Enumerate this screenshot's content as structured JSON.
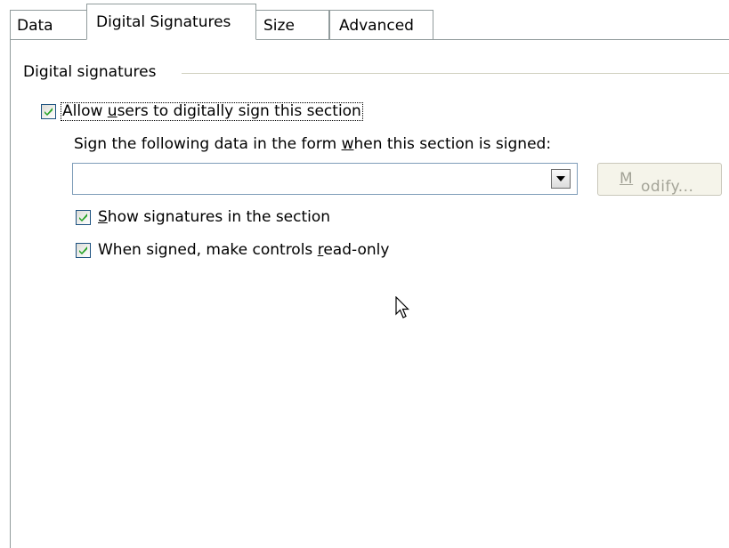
{
  "tabs": [
    {
      "label": "Data"
    },
    {
      "label": "Digital Signatures",
      "active": true
    },
    {
      "label": "Size"
    },
    {
      "label": "Advanced"
    }
  ],
  "group": {
    "label": "Digital signatures"
  },
  "allow_sign": {
    "label_pre": "Allow ",
    "label_mnemonic": "u",
    "label_post": "sers to digitally sign this section",
    "checked": true
  },
  "sign_data": {
    "label_pre": "Sign the following data in the form ",
    "label_mnemonic": "w",
    "label_post": "hen this section is signed:",
    "value": ""
  },
  "modify_button": {
    "label_mnemonic": "M",
    "label_post": "odify...",
    "enabled": false
  },
  "show_signatures": {
    "label_mnemonic": "S",
    "label_post": "how signatures in the section",
    "checked": true
  },
  "read_only": {
    "label_pre": "When signed, make controls ",
    "label_mnemonic": "r",
    "label_post": "ead-only",
    "checked": true
  },
  "colors": {
    "tab_border": "#919b9c",
    "check": "#21a121",
    "disabled_text": "#a3a397"
  },
  "icons": {
    "check": "checkmark-icon",
    "dropdown": "dropdown-arrow-icon",
    "cursor": "mouse-pointer-icon"
  }
}
